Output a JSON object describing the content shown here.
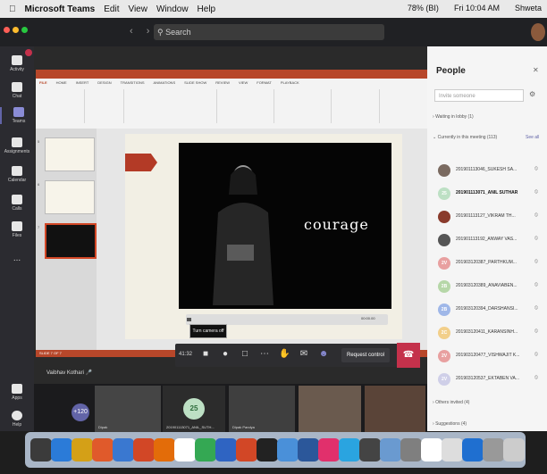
{
  "menubar": {
    "apple": "",
    "app_name": "Microsoft Teams",
    "menus": [
      "Edit",
      "View",
      "Window",
      "Help"
    ],
    "battery": "78% (BI)",
    "datetime": "Fri 10:04 AM",
    "user": "Shweta"
  },
  "titlebar": {
    "search_placeholder": "Search",
    "nav": "‹ ›"
  },
  "rail": {
    "items": [
      {
        "label": "Activity",
        "icon": "bell-icon"
      },
      {
        "label": "Chat",
        "icon": "chat-icon"
      },
      {
        "label": "Teams",
        "icon": "teams-icon"
      },
      {
        "label": "Assignments",
        "icon": "assignments-icon"
      },
      {
        "label": "Calendar",
        "icon": "calendar-icon"
      },
      {
        "label": "Calls",
        "icon": "phone-icon"
      },
      {
        "label": "Files",
        "icon": "file-icon"
      },
      {
        "label": "...",
        "icon": "more-icon"
      },
      {
        "label": "Apps",
        "icon": "apps-icon"
      },
      {
        "label": "Help",
        "icon": "help-icon"
      }
    ]
  },
  "ppt": {
    "ribbon_tabs": [
      "FILE",
      "HOME",
      "INSERT",
      "DESIGN",
      "TRANSITIONS",
      "ANIMATIONS",
      "SLIDE SHOW",
      "REVIEW",
      "VIEW",
      "FORMAT",
      "PLAYBACK"
    ],
    "slide_numbers": [
      "5",
      "6",
      "7"
    ],
    "video_text": "courage",
    "video_time": "00:00.00",
    "status": "SLIDE 7 OF 7"
  },
  "meeting": {
    "presenter": "Vaibhav Kothari",
    "tooltip": "Turn camera off",
    "timer": "41:32",
    "request_control": "Request control",
    "overflow_count": "+120",
    "tiles": [
      {
        "name": "Dipak"
      },
      {
        "name": "201901113071_ANIL_SUTH..."
      },
      {
        "name": "Dipak Pandya"
      },
      {
        "name": ""
      },
      {
        "name": ""
      }
    ],
    "strip_avatar_initials": "25"
  },
  "people": {
    "title": "People",
    "invite_placeholder": "Invite someone",
    "waiting_lobby": "Waiting in lobby (1)",
    "currently_in_meeting": "Currently in this meeting (113)",
    "see_all": "See all",
    "participants": [
      {
        "name": "201901113046_SUKESH SA...",
        "initials": "",
        "color": "#7a6a60",
        "bold": false
      },
      {
        "name": "201901113071_ANIL SUTHAR",
        "initials": "25",
        "color": "#bde0c4",
        "bold": true
      },
      {
        "name": "201901113127_VIKRAM TH...",
        "initials": "",
        "color": "#8a3b2c",
        "bold": false
      },
      {
        "name": "201901113192_ANWAY VAS...",
        "initials": "",
        "color": "#555555",
        "bold": false
      },
      {
        "name": "201903120387_PARTHKUM...",
        "initials": "2V",
        "color": "#e8a0a0",
        "bold": false
      },
      {
        "name": "201903120389_ANAVIABEN...",
        "initials": "2B",
        "color": "#b6d7a8",
        "bold": false
      },
      {
        "name": "201903120394_DARSHANSI...",
        "initials": "2B",
        "color": "#9fb7e8",
        "bold": false
      },
      {
        "name": "201903120411_KARANSINH...",
        "initials": "2C",
        "color": "#f2cf8a",
        "bold": false
      },
      {
        "name": "201903120477_VISHWAJIT K...",
        "initials": "2V",
        "color": "#e8a0a0",
        "bold": false
      },
      {
        "name": "201903120537_EKTABEN VA...",
        "initials": "2V",
        "color": "#cfcfe8",
        "bold": false
      }
    ],
    "others_invited": "Others invited (4)",
    "suggestions": "Suggestions (4)"
  },
  "dock": {
    "icon_colors": [
      "#3b3b3b",
      "#2b7bd8",
      "#d4a017",
      "#e05a2b",
      "#3a78d0",
      "#d24726",
      "#e36c09",
      "#ffffff",
      "#34a853",
      "#2f64c2",
      "#d24726",
      "#222222",
      "#4a90d9",
      "#2b579a",
      "#e1306c",
      "#2aa4e0",
      "#444444",
      "#6a9ad0",
      "#7f7f7f",
      "#ffffff",
      "#dddddd",
      "#1f6fd0",
      "#999999",
      "#cccccc"
    ]
  }
}
